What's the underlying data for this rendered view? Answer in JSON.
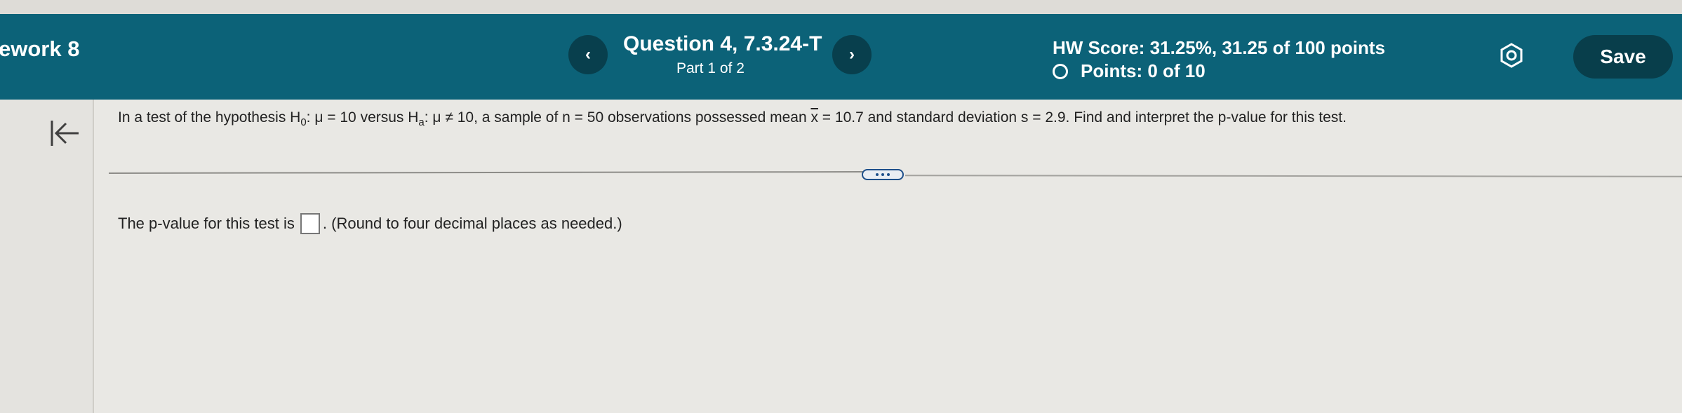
{
  "header": {
    "assignment_title": "ework 8",
    "prev_label": "‹",
    "next_label": "›",
    "question_title": "Question 4, 7.3.24-T",
    "question_part": "Part 1 of 2",
    "hw_score": "HW Score: 31.25%, 31.25 of 100 points",
    "points": "Points: 0 of 10",
    "save_label": "Save",
    "settings_icon": "gear-icon"
  },
  "sidebar": {
    "collapse_icon": "collapse-left-icon"
  },
  "question": {
    "t1": "In a test of the hypothesis H",
    "s1": "0",
    "t2": ": μ = 10 versus H",
    "s2": "a",
    "t3": ": μ ≠ 10, a sample of n = 50 observations possessed mean ",
    "xbar": "x",
    "t4": " = 10.7 and standard deviation s = 2.9. Find and interpret the p-value for this test."
  },
  "more_icon": "more-dots-icon",
  "answer": {
    "prefix": "The p-value for this test is",
    "suffix": ". (Round to four decimal places as needed.)"
  },
  "colors": {
    "header_bg": "#0c6278",
    "button_dark": "#083e4b",
    "page_bg": "#e9e8e4"
  }
}
